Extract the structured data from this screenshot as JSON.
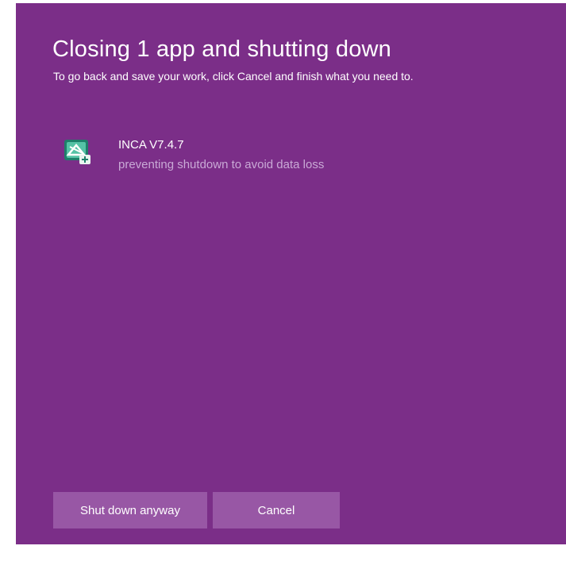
{
  "dialog": {
    "title": "Closing 1 app and shutting down",
    "subtitle": "To go back and save your work, click Cancel and finish what you need to."
  },
  "apps": [
    {
      "name": "INCA V7.4.7",
      "status": "preventing shutdown to avoid data loss",
      "icon": "inca-app-icon"
    }
  ],
  "buttons": {
    "shutdown_label": "Shut down anyway",
    "cancel_label": "Cancel"
  },
  "colors": {
    "background": "#7b2e88",
    "button": "#9857a5",
    "status_text": "#c9a9d6"
  }
}
